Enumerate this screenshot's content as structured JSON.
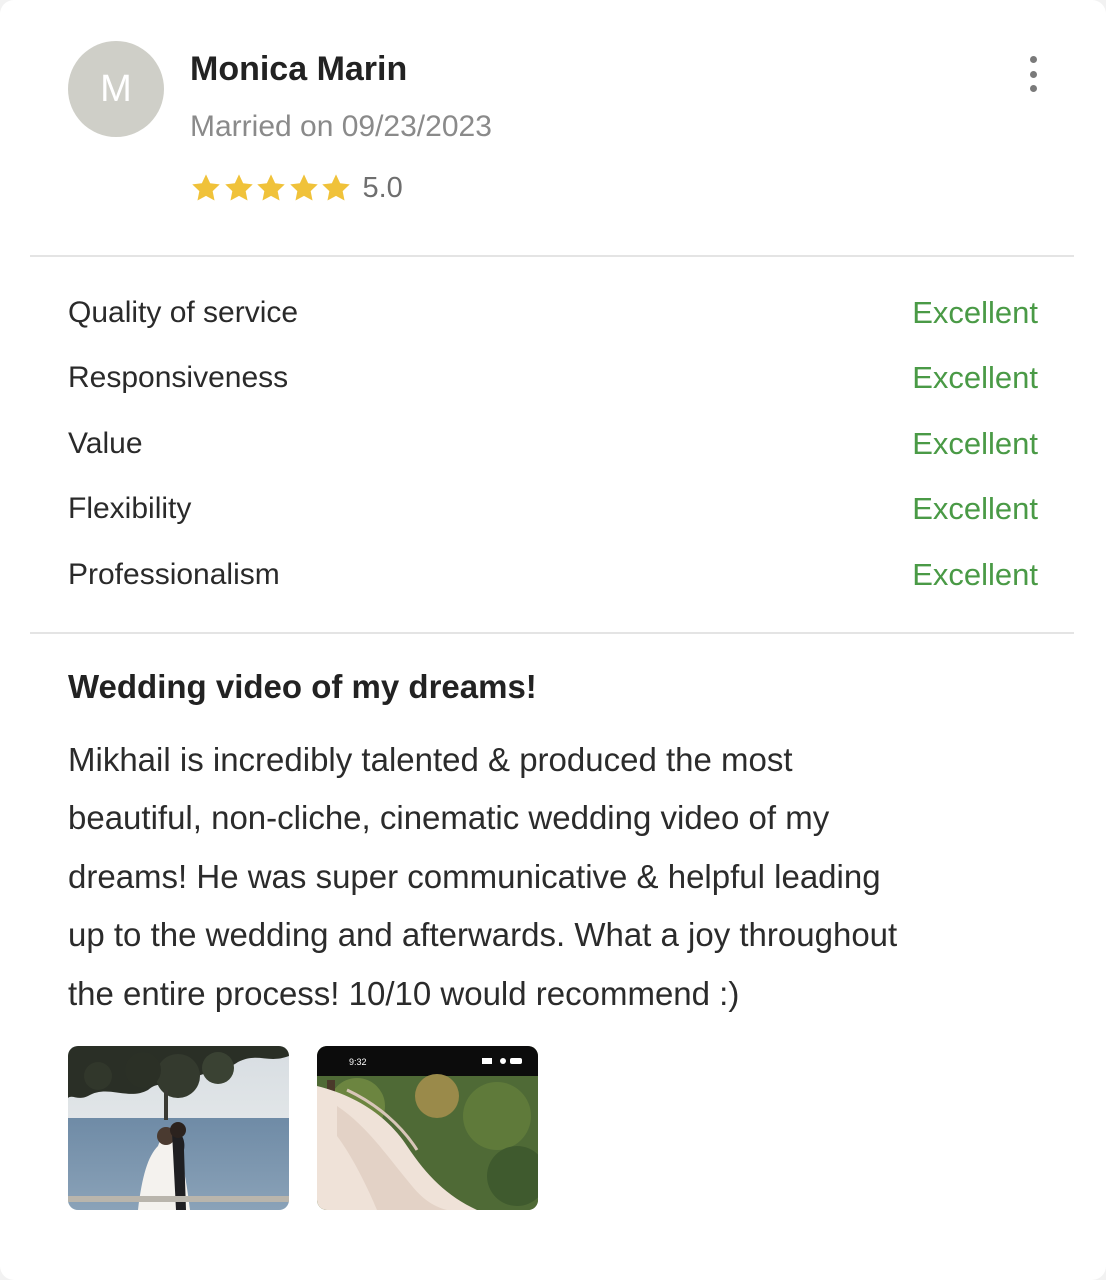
{
  "review": {
    "avatar_initial": "M",
    "author": "Monica Marin",
    "married_on": "Married on 09/23/2023",
    "rating": "5.0",
    "stars": 5,
    "star_color": "#f0c23a",
    "categories": [
      {
        "label": "Quality of service",
        "score": "Excellent"
      },
      {
        "label": "Responsiveness",
        "score": "Excellent"
      },
      {
        "label": "Value",
        "score": "Excellent"
      },
      {
        "label": "Flexibility",
        "score": "Excellent"
      },
      {
        "label": "Professionalism",
        "score": "Excellent"
      }
    ],
    "score_color": "#4a9a46",
    "title": "Wedding video of my dreams!",
    "body_lines": [
      "Mikhail is incredibly talented & produced the most",
      "beautiful, non-cliche, cinematic wedding video of my",
      "dreams! He was super communicative & helpful leading",
      "up to the wedding and afterwards. What a joy throughout",
      "the entire process! 10/10 would recommend :)"
    ],
    "photos": [
      {
        "name": "photo-thumbnail-couple-by-sea"
      },
      {
        "name": "photo-thumbnail-phone-screenshot",
        "status_time": "9:32"
      }
    ]
  },
  "icons": {
    "more": "more-vertical-icon",
    "star": "star-icon"
  }
}
